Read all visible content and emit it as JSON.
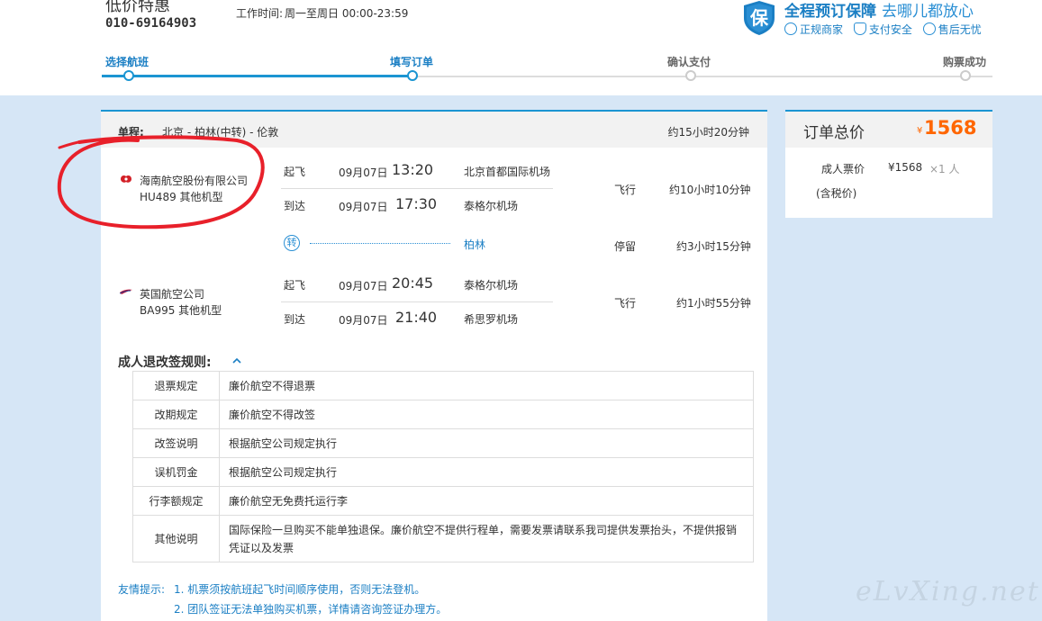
{
  "header": {
    "brand_title": "低价特惠",
    "phone": "010-69164903",
    "work_hours_label": "工作时间:",
    "work_hours_value": "周一至周日 00:00-23:59",
    "guarantee": {
      "shield_char": "保",
      "title": "全程预订保障",
      "slogan": "去哪儿都放心",
      "items": [
        "正规商家",
        "支付安全",
        "售后无忧"
      ]
    }
  },
  "steps": [
    {
      "label": "选择航班",
      "state": "done"
    },
    {
      "label": "填写订单",
      "state": "current"
    },
    {
      "label": "确认支付",
      "state": "todo"
    },
    {
      "label": "购票成功",
      "state": "todo"
    }
  ],
  "trip": {
    "type_label": "单程:",
    "route": "北京 - 柏林(中转) - 伦敦",
    "total_duration": "约15小时20分钟"
  },
  "segments": [
    {
      "airline": "海南航空股份有限公司",
      "flight": "HU489 其他机型",
      "depart_label": "起飞",
      "depart_date": "09月07日",
      "depart_time": "13:20",
      "depart_airport": "北京首都国际机场",
      "arrive_label": "到达",
      "arrive_date": "09月07日",
      "arrive_time": "17:30",
      "arrive_airport": "泰格尔机场",
      "status": "飞行",
      "duration": "约10小时10分钟"
    },
    {
      "airline": "英国航空公司",
      "flight": "BA995 其他机型",
      "depart_label": "起飞",
      "depart_date": "09月07日",
      "depart_time": "20:45",
      "depart_airport": "泰格尔机场",
      "arrive_label": "到达",
      "arrive_date": "09月07日",
      "arrive_time": "21:40",
      "arrive_airport": "希思罗机场",
      "status": "飞行",
      "duration": "约1小时55分钟"
    }
  ],
  "transfer": {
    "icon_char": "转",
    "city": "柏林",
    "status": "停留",
    "duration": "约3小时15分钟"
  },
  "rules": {
    "title": "成人退改签规则:",
    "rows": [
      {
        "k": "退票规定",
        "v": "廉价航空不得退票"
      },
      {
        "k": "改期规定",
        "v": "廉价航空不得改签"
      },
      {
        "k": "改签说明",
        "v": "根据航空公司规定执行"
      },
      {
        "k": "误机罚金",
        "v": "根据航空公司规定执行"
      },
      {
        "k": "行李额规定",
        "v": "廉价航空无免费托运行李"
      },
      {
        "k": "其他说明",
        "v": "国际保险一旦购买不能单独退保。廉价航空不提供行程单，需要发票请联系我司提供发票抬头，不提供报销凭证以及发票"
      }
    ]
  },
  "tips": {
    "label": "友情提示:",
    "lines": [
      "1. 机票须按航班起飞时间顺序使用，否则无法登机。",
      "2. 团队签证无法单独购买机票，详情请咨询签证办理方。"
    ]
  },
  "summary": {
    "title": "订单总价",
    "currency": "¥",
    "total": "1568",
    "adult_label": "成人票价",
    "tax_note": "(含税价)",
    "adult_price": "¥1568",
    "qty": "×1 人"
  },
  "watermark": "eLvXing.net",
  "colors": {
    "accent": "#1b95d2",
    "price": "#ff6600",
    "annotation": "#e8202a",
    "page_bg": "#d6e6f6"
  }
}
